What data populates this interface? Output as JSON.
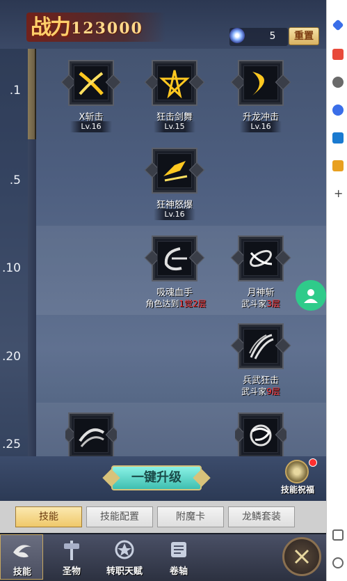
{
  "header": {
    "power_char": "战力",
    "power_value": "123000",
    "skill_points": "5",
    "reset_label": "重置"
  },
  "levels": [
    ".1",
    ".5",
    ".10",
    ".20",
    ".25"
  ],
  "skills": [
    {
      "name": "X斩击",
      "lv": "Lv.16"
    },
    {
      "name": "狂击剑舞",
      "lv": "Lv.15"
    },
    {
      "name": "升龙冲击",
      "lv": "Lv.16"
    },
    {
      "name": "狂神怒爆",
      "lv": "Lv.16"
    },
    {
      "name": "吸魂血手",
      "req_prefix": "角色达到",
      "req_value": "1觉2层"
    },
    {
      "name": "月神斩",
      "req_prefix": "武斗家",
      "req_value": "3层"
    },
    {
      "name": "兵武狂击",
      "req_prefix": "武斗家",
      "req_value": "9层"
    }
  ],
  "actions": {
    "upgrade_label": "一键升级",
    "bless_label": "技能祝福"
  },
  "tabs": [
    {
      "label": "技能",
      "active": true
    },
    {
      "label": "技能配置",
      "active": false
    },
    {
      "label": "附魔卡",
      "active": false
    },
    {
      "label": "龙鳞套装",
      "active": false
    }
  ],
  "nav": [
    {
      "label": "技能",
      "icon": "skill-swirl-icon"
    },
    {
      "label": "圣物",
      "icon": "relic-icon"
    },
    {
      "label": "转职天赋",
      "icon": "talent-icon"
    },
    {
      "label": "卷轴",
      "icon": "scroll-icon"
    }
  ],
  "colors": {
    "accent_gold": "#d9b262",
    "requirement_red": "#ff3030",
    "teal_button": "#3fbfb0",
    "avatar_green": "#2fcb8a"
  }
}
